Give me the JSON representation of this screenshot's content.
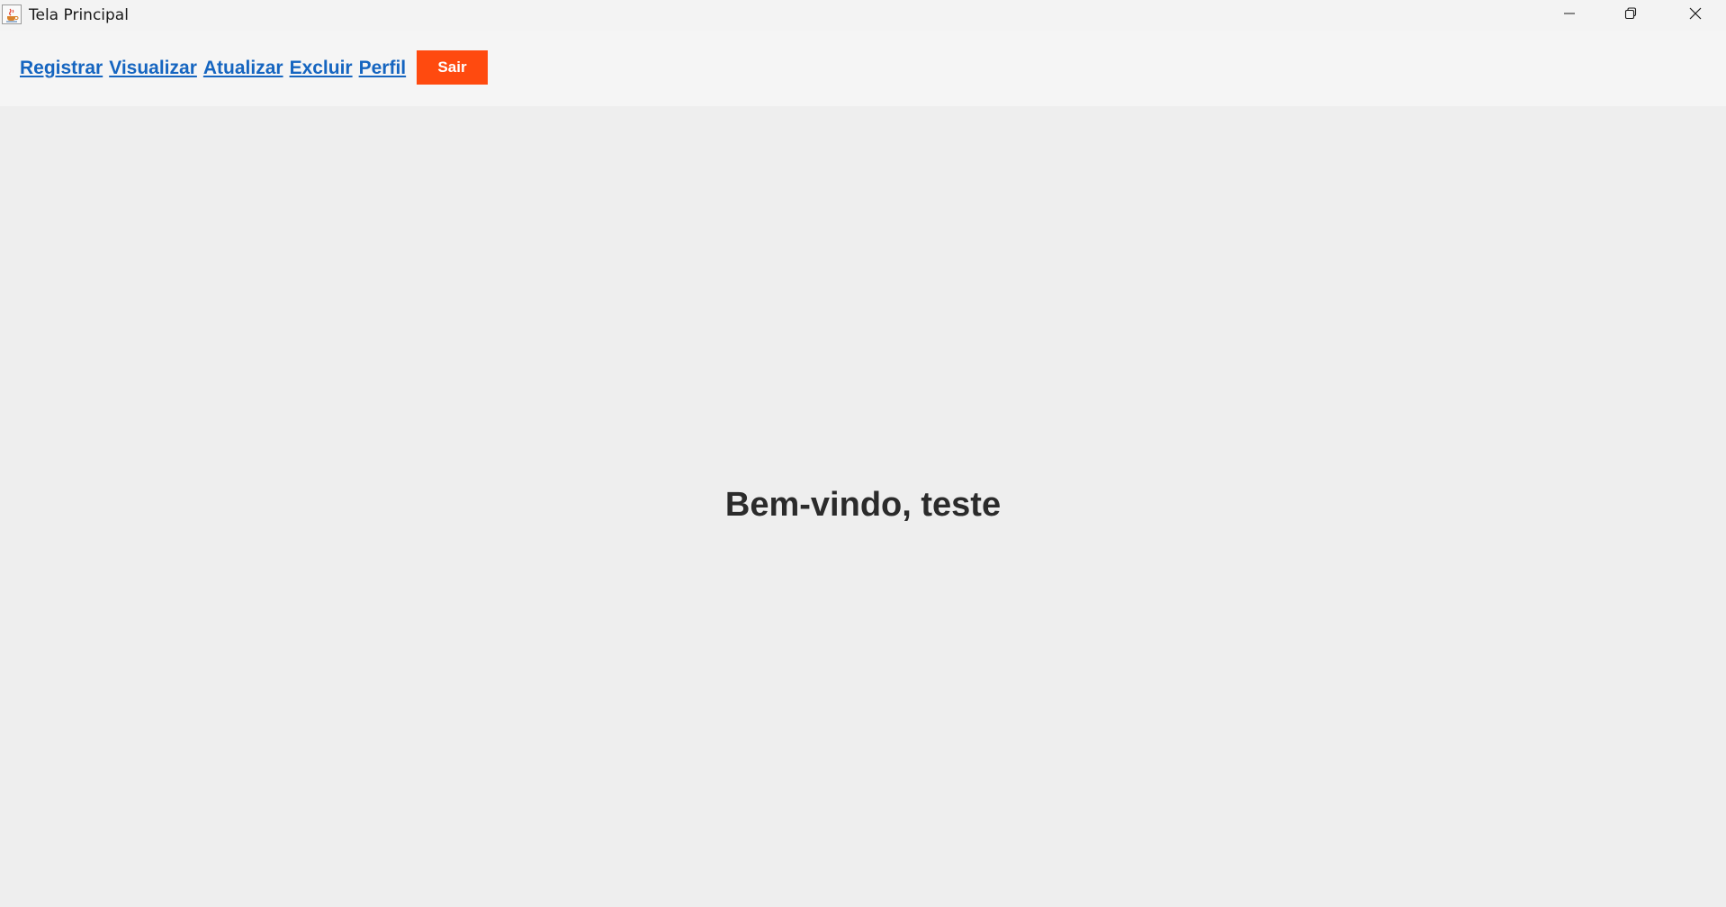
{
  "window": {
    "title": "Tela Principal",
    "icon": "java-cup-icon",
    "controls": {
      "minimize": "minimize-icon",
      "maximize": "restore-icon",
      "close": "close-icon"
    }
  },
  "menu": {
    "links": [
      {
        "label": "Registrar"
      },
      {
        "label": "Visualizar"
      },
      {
        "label": "Atualizar"
      },
      {
        "label": "Excluir"
      },
      {
        "label": "Perfil"
      }
    ],
    "logout_label": "Sair"
  },
  "main": {
    "welcome": "Bem-vindo, teste"
  },
  "colors": {
    "link": "#1565c0",
    "logout_button": "#ff4a0f",
    "background": "#eeeeee",
    "menubar": "#f5f5f5"
  }
}
